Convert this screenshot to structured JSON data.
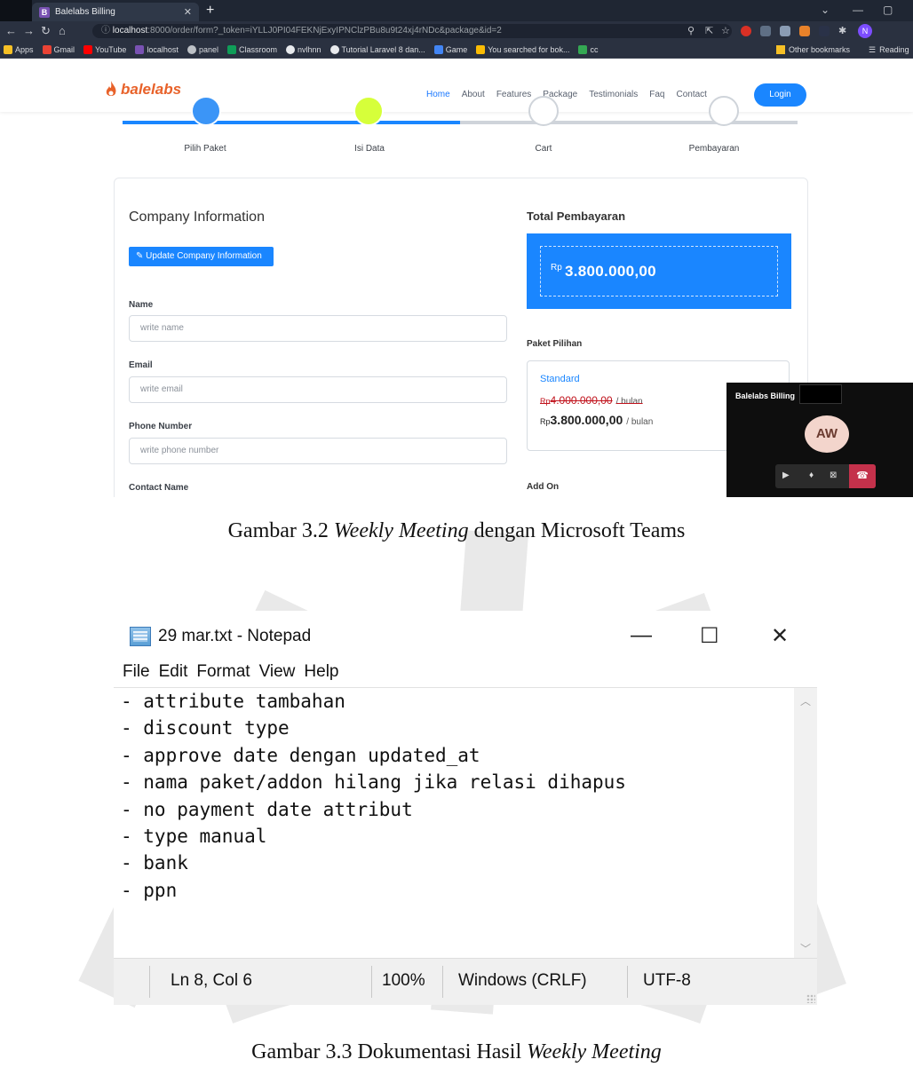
{
  "browser": {
    "tab_title": "Balelabs Billing",
    "url_host": "localhost",
    "url_rest": ":8000/order/form?_token=iYLLJ0PI04FEKNjExyIPNClzPBu8u9t24xj4rNDc&package&id=2",
    "bookmarks": [
      "Apps",
      "Gmail",
      "YouTube",
      "localhost",
      "panel",
      "Classroom",
      "nvlhnn",
      "Tutorial Laravel 8 dan...",
      "Game",
      "You searched for bok...",
      "cc"
    ],
    "bookmarks_right": [
      "Other bookmarks",
      "Reading"
    ],
    "profile_initial": "N"
  },
  "site": {
    "brand": "balelabs",
    "nav": [
      "Home",
      "About",
      "Features",
      "Package",
      "Testimonials",
      "Faq",
      "Contact"
    ],
    "login": "Login",
    "steps": [
      "Pilih Paket",
      "Isi Data",
      "Cart",
      "Pembayaran"
    ],
    "company_heading": "Company Information",
    "update_button": "Update Company Information",
    "fields": [
      {
        "label": "Name",
        "placeholder": "write name"
      },
      {
        "label": "Email",
        "placeholder": "write email"
      },
      {
        "label": "Phone Number",
        "placeholder": "write phone number"
      }
    ],
    "contact_name_label": "Contact Name",
    "total_heading": "Total Pembayaran",
    "total_currency": "Rp",
    "total_value": "3.800.000,00",
    "paket_heading": "Paket Pilihan",
    "paket_name": "Standard",
    "price_old_currency": "Rp",
    "price_old": "4.000.000,00",
    "price_new_currency": "Rp",
    "price_new": "3.800.000,00",
    "per": "/ bulan",
    "addon_heading": "Add On"
  },
  "teams": {
    "title": "Balelabs Billing",
    "avatar": "AW"
  },
  "caption1": {
    "prefix": "Gambar 3.2 ",
    "italic": "Weekly Meeting",
    "suffix": " dengan Microsoft Teams"
  },
  "notepad": {
    "title": "29 mar.txt - Notepad",
    "menu": [
      "File",
      "Edit",
      "Format",
      "View",
      "Help"
    ],
    "lines": [
      "- attribute tambahan",
      "- discount type",
      "- approve date dengan updated_at",
      "- nama paket/addon hilang jika relasi dihapus",
      "- no payment date attribut",
      "- type manual",
      "- bank",
      "- ppn"
    ],
    "status": {
      "position": "Ln 8, Col 6",
      "zoom": "100%",
      "eol": "Windows (CRLF)",
      "encoding": "UTF-8"
    }
  },
  "caption2": {
    "prefix": "Gambar 3.3 Dokumentasi Hasil ",
    "italic": "Weekly Meeting",
    "suffix": ""
  }
}
